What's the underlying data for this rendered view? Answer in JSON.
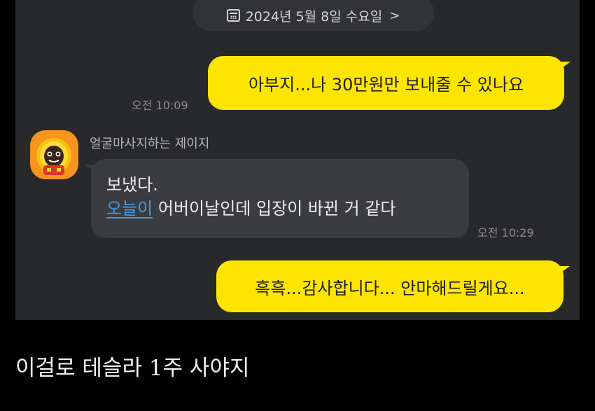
{
  "date_header": {
    "icon": "calendar-icon",
    "label": "2024년 5월 8일 수요일",
    "chevron": ">"
  },
  "messages": [
    {
      "from": "me",
      "text": "아부지...나 30만원만 보내줄 수 있나요",
      "time": "오전 10:09"
    },
    {
      "from": "other",
      "sender": "얼굴마사지하는 제이지",
      "line1": "보냈다.",
      "link": "오늘이",
      "line2_rest": " 어버이날인데 입장이 바뀐 거 같다",
      "time": "오전 10:29"
    },
    {
      "from": "me",
      "text": "흑흑...감사합니다... 안마해드릴게요..."
    }
  ],
  "caption": "이걸로 테슬라 1주 사야지",
  "colors": {
    "chat_background": "#28292b",
    "my_bubble": "#fee500",
    "other_bubble": "#3b3c3f",
    "link": "#3d9be9",
    "avatar_background": "#f7941d"
  }
}
